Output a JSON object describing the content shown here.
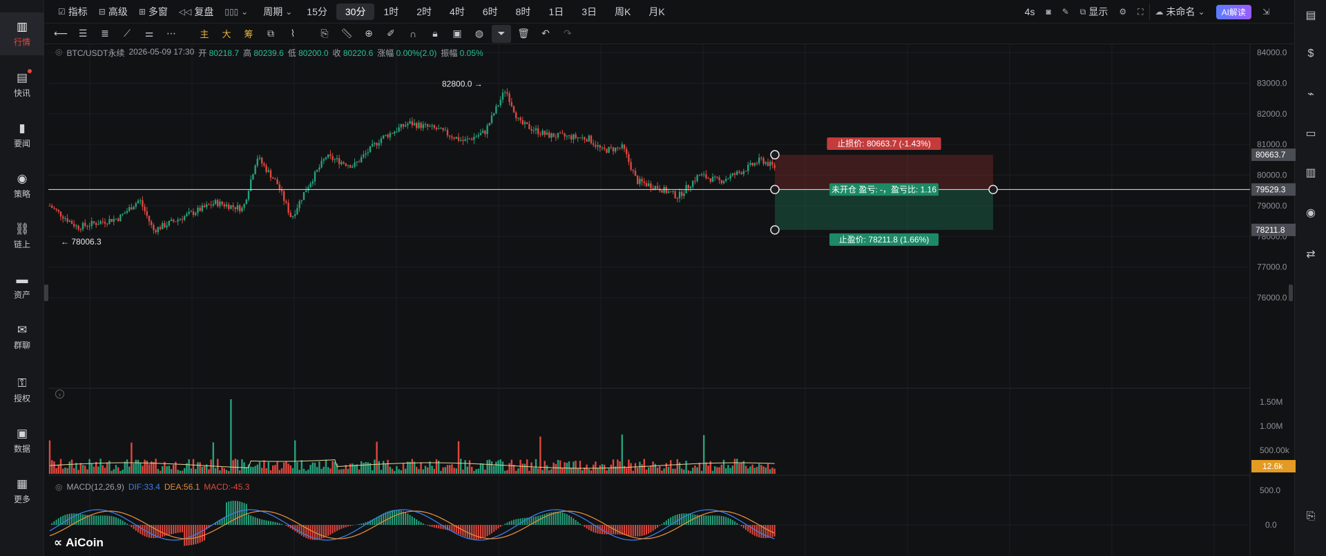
{
  "left_nav": [
    {
      "label": "行情",
      "icon": "bar-chart-icon",
      "active": true
    },
    {
      "label": "快讯",
      "icon": "news-icon",
      "active": false,
      "dot": true
    },
    {
      "label": "要闻",
      "icon": "document-icon",
      "active": false
    },
    {
      "label": "策略",
      "icon": "robot-icon",
      "active": false
    },
    {
      "label": "链上",
      "icon": "link-icon",
      "active": false
    },
    {
      "label": "资产",
      "icon": "wallet-icon",
      "active": false
    },
    {
      "label": "群聊",
      "icon": "chat-icon",
      "active": false
    },
    {
      "label": "授权",
      "icon": "key-icon",
      "active": false
    },
    {
      "label": "数据",
      "icon": "monitor-icon",
      "active": false
    },
    {
      "label": "更多",
      "icon": "grid-icon",
      "active": false
    }
  ],
  "topbar": {
    "tools": [
      {
        "label": "指标",
        "icon": "indicator-icon"
      },
      {
        "label": "高级",
        "icon": "advanced-icon"
      },
      {
        "label": "多窗",
        "icon": "multi-window-icon"
      },
      {
        "label": "复盘",
        "icon": "replay-icon"
      },
      {
        "label": "",
        "icon": "candle-type-icon"
      }
    ],
    "periods": [
      "周期",
      "15分",
      "30分",
      "1时",
      "2时",
      "4时",
      "6时",
      "8时",
      "1日",
      "3日",
      "周K",
      "月K"
    ],
    "active_period": "30分",
    "right": {
      "countdown": "4s",
      "display_label": "显示",
      "layout_name": "未命名",
      "ai_label": "AI解读"
    }
  },
  "chart": {
    "symbol": "BTC/USDT永续",
    "datetime": "2026-05-09 17:30",
    "open_label": "开",
    "open": "80218.7",
    "high_label": "高",
    "high": "80239.6",
    "low_label": "低",
    "low": "80200.0",
    "close_label": "收",
    "close": "80220.6",
    "change_label": "涨幅",
    "change": "0.00%(2.0)",
    "amplitude_label": "振幅",
    "amplitude": "0.05%",
    "high_marker": "82800.0 →",
    "low_marker": "← 78006.3",
    "price_axis": [
      "84000.0",
      "83000.0",
      "82000.0",
      "81000.0",
      "80000.0",
      "79000.0",
      "78000.0",
      "77000.0",
      "76000.0"
    ],
    "price_tags": [
      {
        "value": "80663.7",
        "color": "#4a4d54"
      },
      {
        "value": "79529.3",
        "color": "#4a4d54"
      },
      {
        "value": "78211.8",
        "color": "#4a4d54"
      }
    ],
    "stop_loss": "止损价: 80663.7 (-1.43%)",
    "position_label": "未开仓  盈亏: -，盈亏比: 1.16",
    "take_profit": "止盈价: 78211.8 (1.66%)"
  },
  "volume": {
    "axis": [
      "1.50M",
      "1.00M",
      "500.00k"
    ],
    "current": "12.6k"
  },
  "macd": {
    "name": "MACD(12,26,9)",
    "dif": "DIF:33.4",
    "dea": "DEA:56.1",
    "macd": "MACD:-45.3",
    "axis": [
      "500.0",
      "0.0"
    ]
  },
  "logo": "AiCoin",
  "colors": {
    "up": "#26a17b",
    "down": "#e0483e",
    "accent": "#e8463c",
    "ma": "#e8d79c"
  }
}
